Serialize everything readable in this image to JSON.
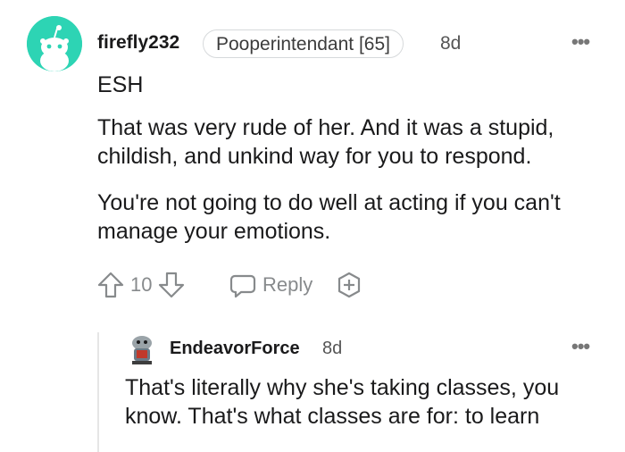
{
  "comment": {
    "username": "firefly232",
    "flair": "Pooperintendant [65]",
    "time": "8d",
    "paragraphs": [
      "ESH",
      "That was very rude of her. And it was a stupid, childish, and unkind way for you to respond.",
      "You're not going to do well at acting if you can't manage your emotions."
    ],
    "votes": "10",
    "reply_label": "Reply",
    "more_label": "•••"
  },
  "reply": {
    "username": "EndeavorForce",
    "time": "8d",
    "text": "That's literally why she's taking classes, you know. That's what classes are for: to learn",
    "more_label": "•••"
  },
  "colors": {
    "avatar_bg": "#2dd4b4",
    "text": "#1a1a1b",
    "muted": "#878a8c"
  },
  "icons": [
    "snoo-avatar",
    "upvote-arrow-icon",
    "downvote-arrow-icon",
    "comment-bubble-icon",
    "award-plus-icon",
    "overflow-dots-icon",
    "user-avatar"
  ]
}
